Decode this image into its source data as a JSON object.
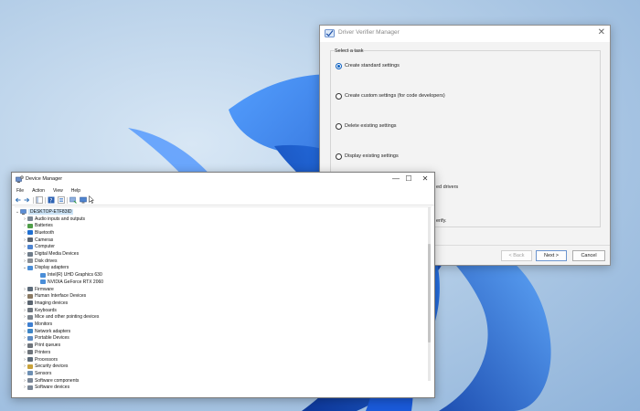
{
  "driver_verifier": {
    "title": "Driver Verifier Manager",
    "close_glyph": "✕",
    "group_label": "Select a task",
    "options": [
      {
        "label": "Create standard settings",
        "checked": true
      },
      {
        "label": "Create custom settings (for code developers)",
        "checked": false
      },
      {
        "label": "Delete existing settings",
        "checked": false
      },
      {
        "label": "Display existing settings",
        "checked": false
      }
    ],
    "partial_text_1": "ed drivers",
    "partial_text_2": "erify.",
    "buttons": {
      "back": "< Back",
      "next": "Next >",
      "cancel": "Cancel"
    }
  },
  "device_manager": {
    "title": "Device Manager",
    "window_controls": {
      "minimize": "—",
      "maximize": "☐",
      "close": "✕"
    },
    "menu": [
      "File",
      "Action",
      "View",
      "Help"
    ],
    "root": "DESKTOP-ETF83ID",
    "tree": [
      {
        "label": "Audio inputs and outputs",
        "icon": "speaker-icon",
        "expanded": false,
        "depth": 1
      },
      {
        "label": "Batteries",
        "icon": "battery-icon",
        "expanded": false,
        "depth": 1
      },
      {
        "label": "Bluetooth",
        "icon": "bluetooth-icon",
        "expanded": false,
        "depth": 1
      },
      {
        "label": "Cameras",
        "icon": "camera-icon",
        "expanded": false,
        "depth": 1
      },
      {
        "label": "Computer",
        "icon": "computer-icon",
        "expanded": false,
        "depth": 1
      },
      {
        "label": "Digital Media Devices",
        "icon": "media-icon",
        "expanded": false,
        "depth": 1
      },
      {
        "label": "Disk drives",
        "icon": "disk-icon",
        "expanded": false,
        "depth": 1
      },
      {
        "label": "Display adapters",
        "icon": "display-icon",
        "expanded": true,
        "depth": 1
      },
      {
        "label": "Intel(R) UHD Graphics 630",
        "icon": "display-icon",
        "expanded": null,
        "depth": 2
      },
      {
        "label": "NVIDIA GeForce RTX 2060",
        "icon": "display-icon",
        "expanded": null,
        "depth": 2
      },
      {
        "label": "Firmware",
        "icon": "chip-icon",
        "expanded": false,
        "depth": 1
      },
      {
        "label": "Human Interface Devices",
        "icon": "hid-icon",
        "expanded": false,
        "depth": 1
      },
      {
        "label": "Imaging devices",
        "icon": "camera-icon",
        "expanded": false,
        "depth": 1
      },
      {
        "label": "Keyboards",
        "icon": "keyboard-icon",
        "expanded": false,
        "depth": 1
      },
      {
        "label": "Mice and other pointing devices",
        "icon": "mouse-icon",
        "expanded": false,
        "depth": 1
      },
      {
        "label": "Monitors",
        "icon": "monitor-icon",
        "expanded": false,
        "depth": 1
      },
      {
        "label": "Network adapters",
        "icon": "network-icon",
        "expanded": false,
        "depth": 1
      },
      {
        "label": "Portable Devices",
        "icon": "portable-icon",
        "expanded": false,
        "depth": 1
      },
      {
        "label": "Print queues",
        "icon": "printer-icon",
        "expanded": false,
        "depth": 1
      },
      {
        "label": "Printers",
        "icon": "printer-icon",
        "expanded": false,
        "depth": 1
      },
      {
        "label": "Processors",
        "icon": "chip-icon",
        "expanded": false,
        "depth": 1
      },
      {
        "label": "Security devices",
        "icon": "security-icon",
        "expanded": false,
        "depth": 1
      },
      {
        "label": "Sensors",
        "icon": "sensor-icon",
        "expanded": false,
        "depth": 1
      },
      {
        "label": "Software components",
        "icon": "component-icon",
        "expanded": false,
        "depth": 1
      },
      {
        "label": "Software devices",
        "icon": "component-icon",
        "expanded": false,
        "depth": 1
      }
    ]
  },
  "colors": {
    "accent": "#0a5fc1",
    "selection": "#cce4f7",
    "wallpaper_blue": "#1565d8"
  }
}
